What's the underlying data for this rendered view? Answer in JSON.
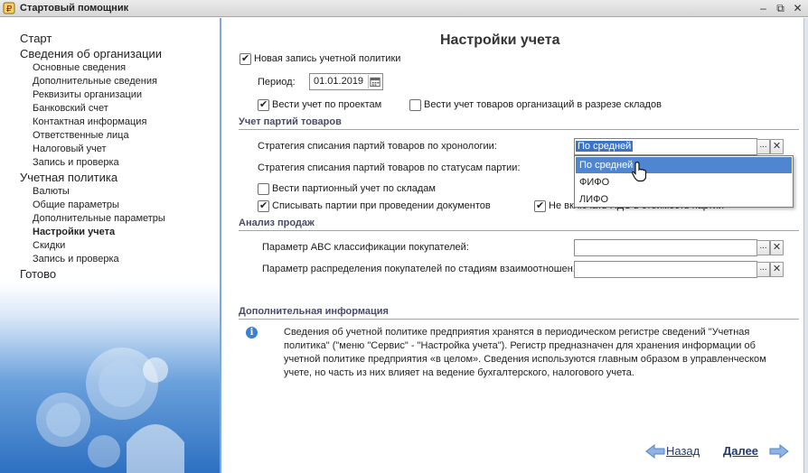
{
  "window": {
    "title": "Стартовый помощник",
    "controls": [
      "‒",
      "⧉",
      "✕"
    ]
  },
  "sidebar": {
    "items": [
      {
        "label": "Старт",
        "level": 0
      },
      {
        "label": "Сведения об организации",
        "level": 0
      },
      {
        "label": "Основные сведения",
        "level": 1
      },
      {
        "label": "Дополнительные сведения",
        "level": 1
      },
      {
        "label": "Реквизиты организации",
        "level": 1
      },
      {
        "label": "Банковский счет",
        "level": 1
      },
      {
        "label": "Контактная информация",
        "level": 1
      },
      {
        "label": "Ответственные лица",
        "level": 1
      },
      {
        "label": "Налоговый учет",
        "level": 1
      },
      {
        "label": "Запись и проверка",
        "level": 1
      },
      {
        "label": "Учетная политика",
        "level": 0
      },
      {
        "label": "Валюты",
        "level": 1
      },
      {
        "label": "Общие параметры",
        "level": 1
      },
      {
        "label": "Дополнительные параметры",
        "level": 1
      },
      {
        "label": "Настройки учета",
        "level": 1,
        "active": true
      },
      {
        "label": "Скидки",
        "level": 1
      },
      {
        "label": "Запись и проверка",
        "level": 1
      },
      {
        "label": "Готово",
        "level": 0
      }
    ]
  },
  "main": {
    "title": "Настройки учета",
    "new_record": {
      "label": "Новая запись учетной политики",
      "checked": true
    },
    "period": {
      "label": "Период:",
      "value": "01.01.2019"
    },
    "projects": {
      "label": "Вести учет по проектам",
      "checked": true
    },
    "warehouses": {
      "label": "Вести учет товаров организаций в разрезе складов",
      "checked": false
    },
    "batches_section": {
      "title": "Учет партий товаров",
      "strategy_chrono": {
        "label": "Стратегия списания партий товаров по хронологии:",
        "value": "По средней"
      },
      "strategy_status": {
        "label": "Стратегия списания партий товаров по статусам партии:"
      },
      "batch_by_wh": {
        "label": "Вести партионный учет по складам",
        "checked": false
      },
      "write_off": {
        "label": "Списывать партии при проведении документов",
        "checked": true
      },
      "vat": {
        "label": "Не включать НДС в стоимость партий",
        "checked": true
      },
      "dropdown": {
        "options": [
          "По средней",
          "ФИФО",
          "ЛИФО"
        ],
        "highlighted": 0
      }
    },
    "sales_section": {
      "title": "Анализ продаж",
      "abc": {
        "label": "Параметр ABC классификации покупателей:",
        "value": ""
      },
      "stages": {
        "label": "Параметр распределения покупателей по стадиям взаимоотношен...",
        "value": ""
      }
    },
    "info_section": {
      "title": "Дополнительная информация",
      "text": "Сведения об учетной политике предприятия хранятся в периодическом регистре сведений \"Учетная политика\" (\"меню \"Сервис\" -  \"Настройка учета\"). Регистр предназначен для хранения информации об учетной политике предприятия «в целом». Сведения используются главным образом в управленческом учете, но часть из них влияет на ведение бухгалтерского, налогового учета."
    },
    "footer": {
      "back_label": "Назад",
      "next_label": "Далее"
    },
    "field_buttons": {
      "select": "...",
      "clear": "✕"
    }
  },
  "colors": {
    "accent": "#3a74c6",
    "section_line": "#c9a44a",
    "sidebar_gradient_end": "#2d6fc1",
    "arrow": "#4f86cf"
  }
}
